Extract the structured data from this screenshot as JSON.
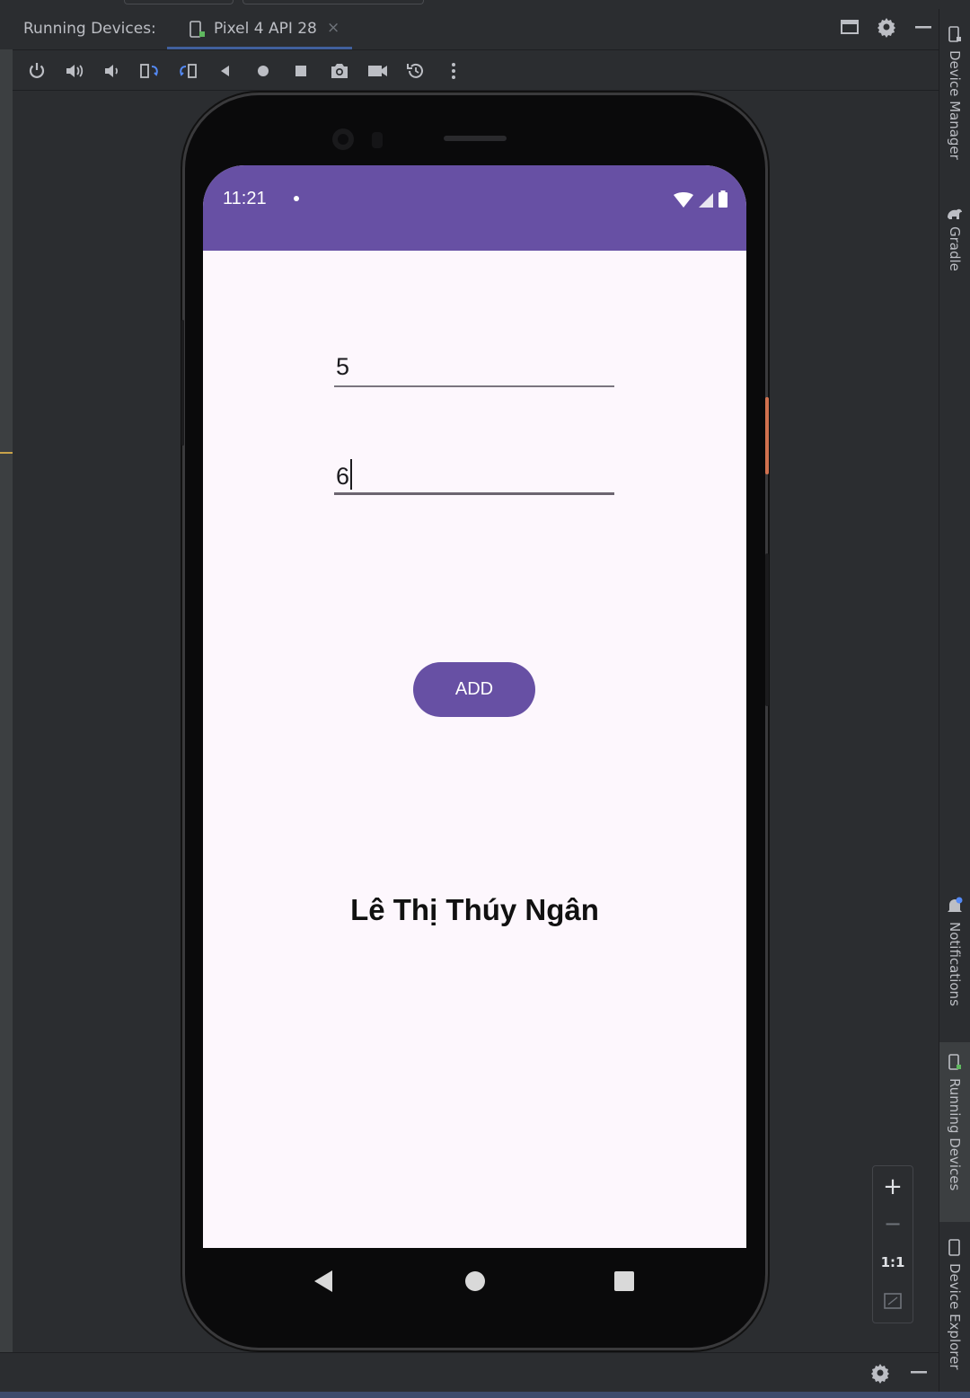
{
  "ide": {
    "panel_title": "Running Devices:",
    "device_tab": {
      "label": "Pixel 4 API 28",
      "close": "×",
      "icon": "device-icon"
    },
    "window_buttons": [
      "maximize-icon",
      "gear-icon",
      "minimize-icon"
    ],
    "toolbar_icons": [
      "power-icon",
      "volume-up-icon",
      "volume-down-icon",
      "rotate-left-icon",
      "rotate-right-icon",
      "back-icon",
      "home-icon",
      "overview-icon",
      "screenshot-icon",
      "screen-record-icon",
      "reset-icon",
      "more-icon"
    ],
    "right_tools": {
      "device_manager": "Device Manager",
      "gradle": "Gradle",
      "notifications": "Notifications",
      "running_devices": "Running Devices",
      "device_explorer": "Device Explorer"
    },
    "zoom": {
      "plus": "+",
      "minus": "−",
      "one_to_one": "1:1"
    },
    "accent": "#548af7"
  },
  "phone": {
    "status": {
      "time": "11:21",
      "icons": [
        "wifi-icon",
        "signal-icon",
        "battery-icon"
      ]
    },
    "field1": {
      "value": "5"
    },
    "field2": {
      "value": "6"
    },
    "button": {
      "label": "ADD"
    },
    "name_text": "Lê Thị Thúy Ngân",
    "colors": {
      "primary": "#6750a4",
      "background": "#fdf7fd"
    },
    "nav": [
      "nav-back-icon",
      "nav-home-icon",
      "nav-recents-icon"
    ]
  }
}
